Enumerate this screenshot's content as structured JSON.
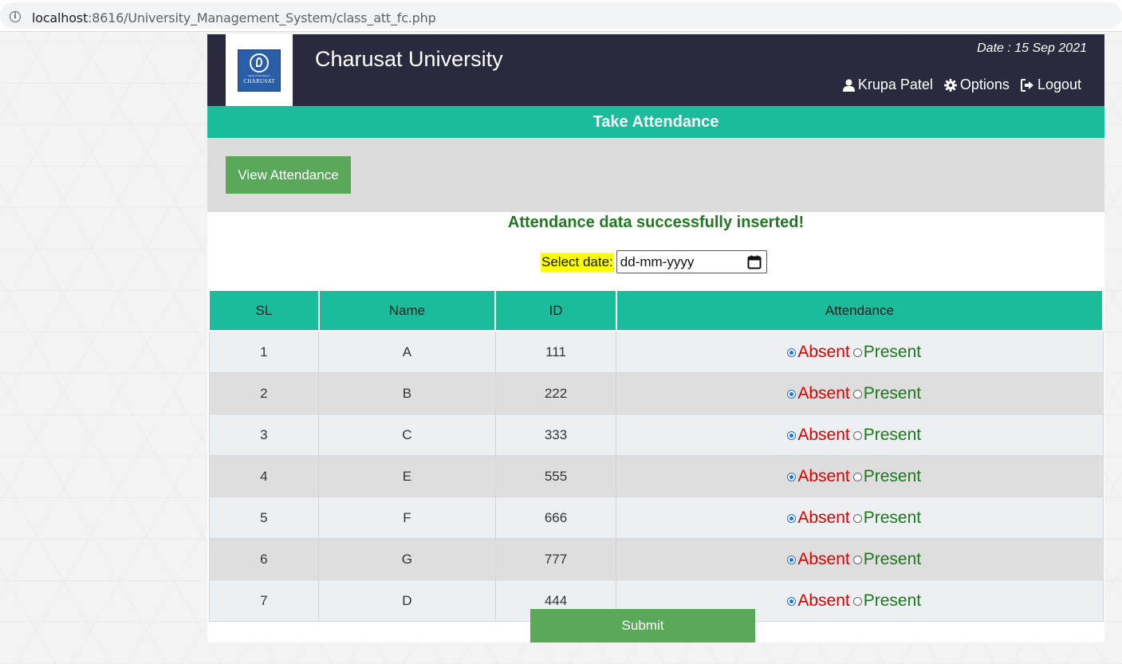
{
  "browser": {
    "url_host": "localhost",
    "url_path": ":8616/University_Management_System/class_att_fc.php",
    "info_icon": "info-icon"
  },
  "header": {
    "logo_tagline": "Spirit of Excellence",
    "logo_text": "CHARUSAT",
    "title": "Charusat University",
    "date": "Date : 15 Sep 2021",
    "nav": {
      "user": "Krupa Patel",
      "options": "Options",
      "logout": "Logout"
    }
  },
  "page_bar": {
    "title": "Take Attendance"
  },
  "actions": {
    "view_attendance": "View Attendance"
  },
  "message": "Attendance data successfully inserted!",
  "date_select": {
    "label": "Select date:",
    "placeholder": "dd-mm-yyyy"
  },
  "table": {
    "headers": [
      "SL",
      "Name",
      "ID",
      "Attendance"
    ],
    "absent_label": "Absent",
    "present_label": "Present",
    "rows": [
      {
        "sl": "1",
        "name": "A",
        "id": "111",
        "status": "Absent"
      },
      {
        "sl": "2",
        "name": "B",
        "id": "222",
        "status": "Absent"
      },
      {
        "sl": "3",
        "name": "C",
        "id": "333",
        "status": "Absent"
      },
      {
        "sl": "4",
        "name": "E",
        "id": "555",
        "status": "Absent"
      },
      {
        "sl": "5",
        "name": "F",
        "id": "666",
        "status": "Absent"
      },
      {
        "sl": "6",
        "name": "G",
        "id": "777",
        "status": "Absent"
      },
      {
        "sl": "7",
        "name": "D",
        "id": "444",
        "status": "Absent"
      }
    ]
  },
  "submit_label": "Submit",
  "colors": {
    "header_bg": "#2a2a3e",
    "accent": "#1abc9c",
    "button": "#5aa95a",
    "success_text": "#1f7a1f",
    "absent": "#dd0000",
    "present": "#1a7a1a",
    "highlight": "#ffff00"
  }
}
